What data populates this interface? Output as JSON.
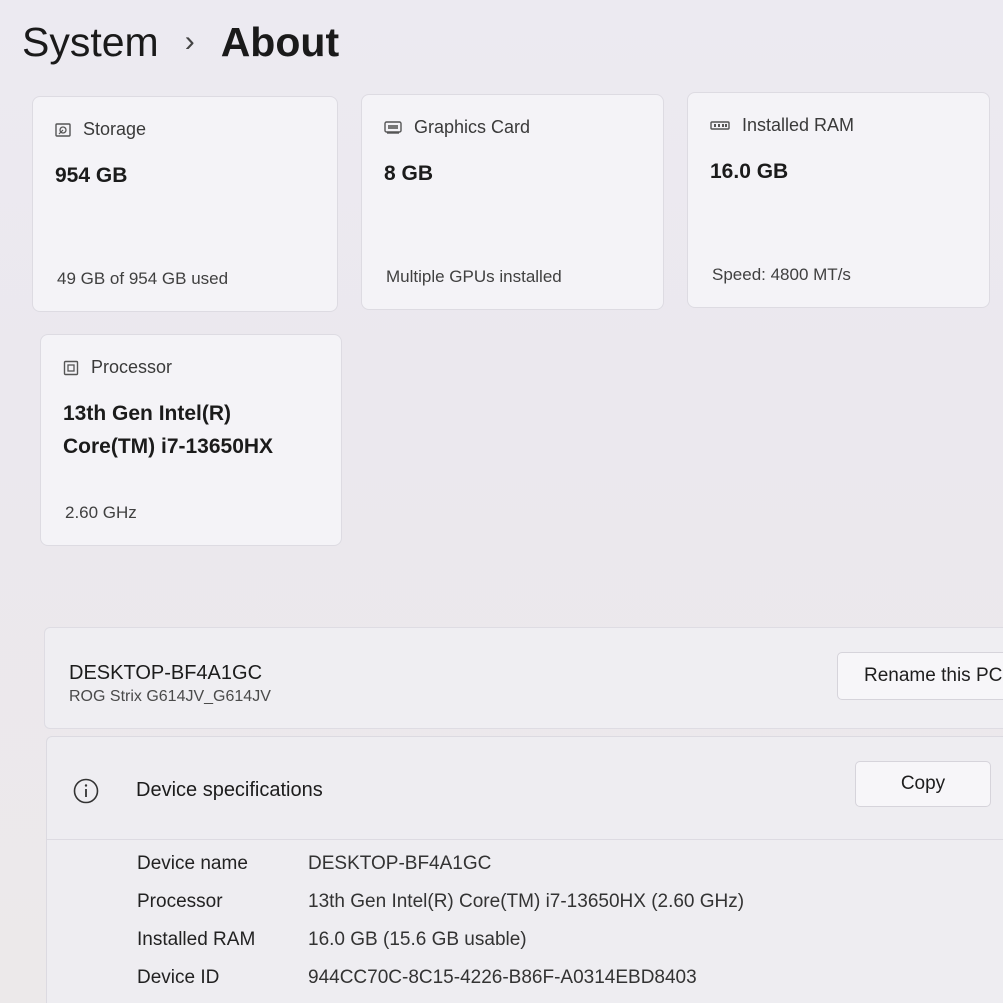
{
  "breadcrumb": {
    "parent": "System",
    "separator": "›",
    "current": "About"
  },
  "cards": {
    "storage": {
      "icon": "storage-icon",
      "title": "Storage",
      "value": "954 GB",
      "footer": "49 GB of 954 GB used"
    },
    "gpu": {
      "icon": "graphics-card-icon",
      "title": "Graphics Card",
      "value": "8 GB",
      "footer": "Multiple GPUs installed"
    },
    "ram": {
      "icon": "ram-icon",
      "title": "Installed RAM",
      "value": "16.0 GB",
      "footer": "Speed: 4800 MT/s"
    },
    "cpu": {
      "icon": "processor-icon",
      "title": "Processor",
      "value_line1": "13th Gen Intel(R)",
      "value_line2": "Core(TM) i7-13650HX",
      "footer": "2.60 GHz"
    }
  },
  "rename": {
    "hostname": "DESKTOP-BF4A1GC",
    "model": "ROG Strix G614JV_G614JV",
    "button_label": "Rename this PC"
  },
  "specs": {
    "title": "Device specifications",
    "copy_label": "Copy",
    "rows": [
      {
        "label": "Device name",
        "value": "DESKTOP-BF4A1GC"
      },
      {
        "label": "Processor",
        "value": "13th Gen Intel(R) Core(TM) i7-13650HX (2.60 GHz)"
      },
      {
        "label": "Installed RAM",
        "value": "16.0 GB (15.6 GB usable)"
      },
      {
        "label": "Device ID",
        "value": "944CC70C-8C15-4226-B86F-A0314EBD8403"
      }
    ]
  },
  "colors": {
    "background": "#ebe8ee",
    "card": "#f4f3f7",
    "text": "#1b1b1b"
  }
}
